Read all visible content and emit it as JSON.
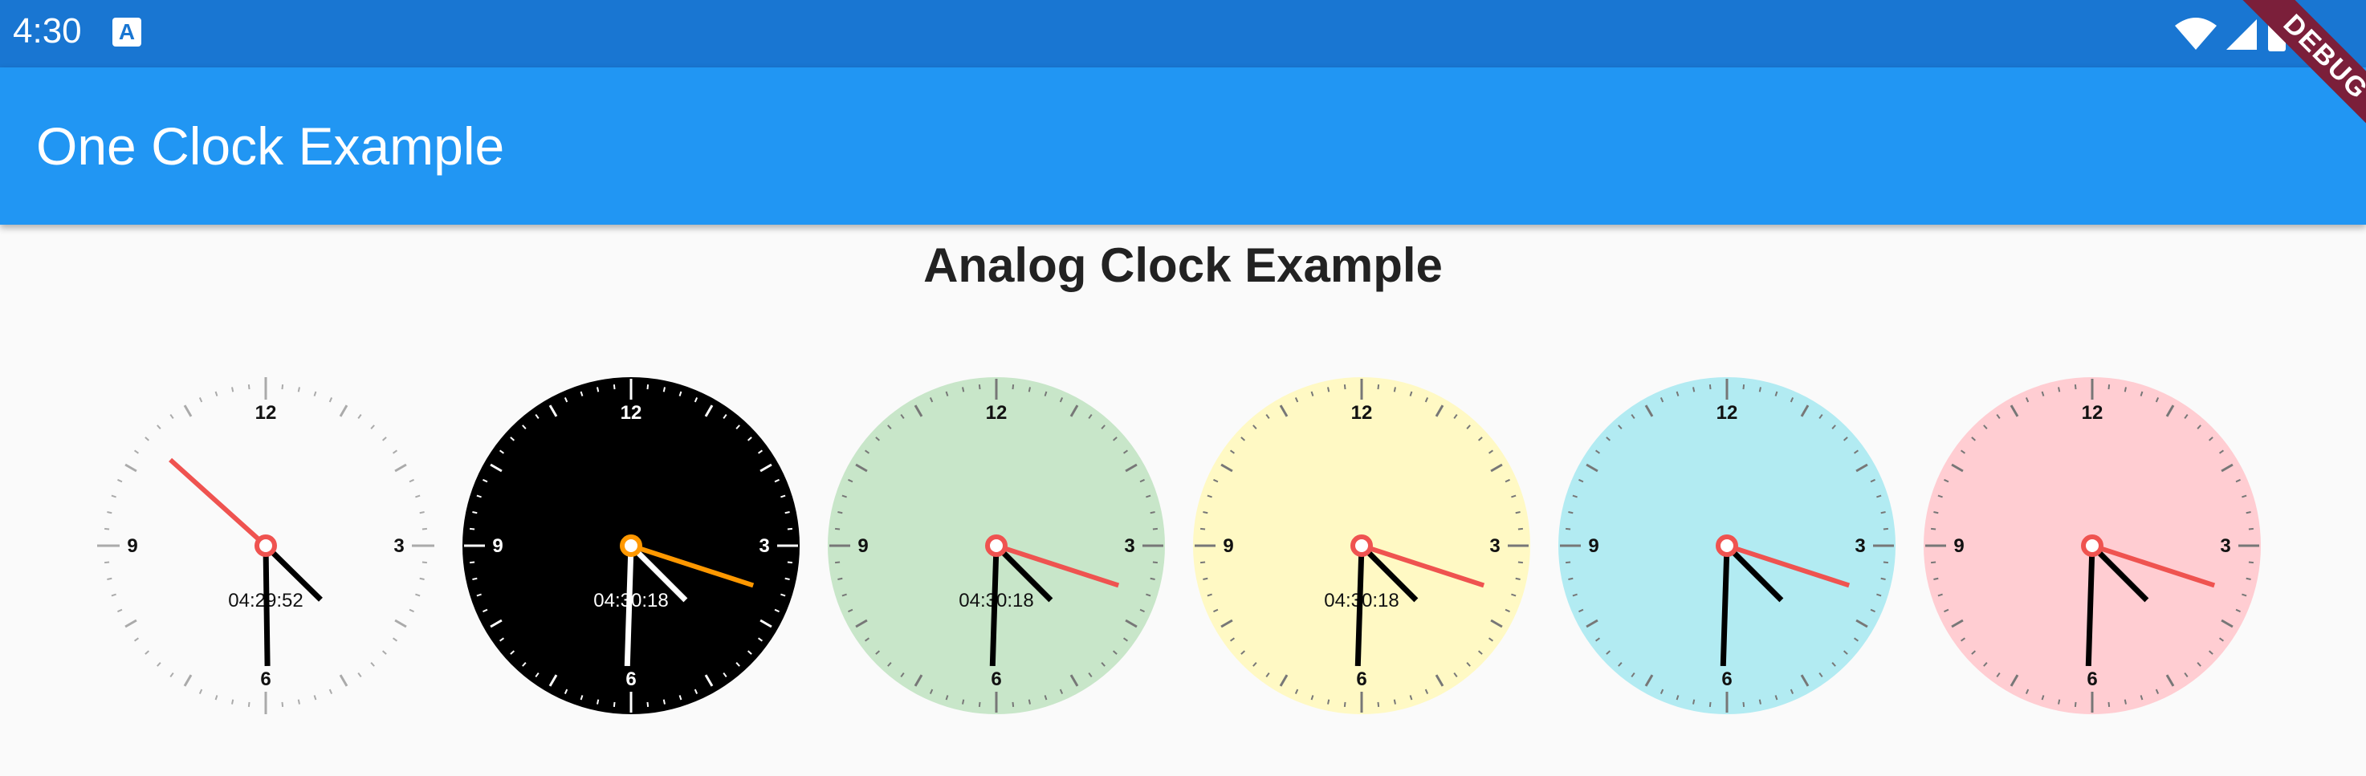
{
  "status_bar": {
    "time": "4:30",
    "notification_icon": "A",
    "icons": [
      "wifi-icon",
      "cellular-signal-icon",
      "battery-icon"
    ]
  },
  "app_bar": {
    "title": "One Clock Example"
  },
  "debug_banner": {
    "label": "DEBUG",
    "color": "#7b1f3a"
  },
  "page": {
    "heading": "Analog Clock Example"
  },
  "clocks": [
    {
      "face": "#fafafa",
      "numbers": "#111111",
      "ticks": "#aaaaaa",
      "hour_hand": "#000000",
      "minute_hand": "#000000",
      "second_hand": "#ef5350",
      "center": "#ef5350",
      "digital": "04:29:52",
      "hour": 4,
      "minute": 29,
      "second": 52,
      "digital_color": "#111111"
    },
    {
      "face": "#000000",
      "numbers": "#ffffff",
      "ticks": "#ffffff",
      "hour_hand": "#ffffff",
      "minute_hand": "#ffffff",
      "second_hand": "#ff9800",
      "center": "#ff9800",
      "digital": "04:30:18",
      "hour": 4,
      "minute": 30,
      "second": 18,
      "digital_color": "#ffffff"
    },
    {
      "face": "#c8e6c9",
      "numbers": "#111111",
      "ticks": "#777777",
      "hour_hand": "#000000",
      "minute_hand": "#000000",
      "second_hand": "#ef5350",
      "center": "#ef5350",
      "digital": "04:30:18",
      "hour": 4,
      "minute": 30,
      "second": 18,
      "digital_color": "#111111"
    },
    {
      "face": "#fff9c4",
      "numbers": "#111111",
      "ticks": "#777777",
      "hour_hand": "#000000",
      "minute_hand": "#000000",
      "second_hand": "#ef5350",
      "center": "#ef5350",
      "digital": "04:30:18",
      "hour": 4,
      "minute": 30,
      "second": 18,
      "digital_color": "#111111"
    },
    {
      "face": "#b2ebf2",
      "numbers": "#111111",
      "ticks": "#777777",
      "hour_hand": "#000000",
      "minute_hand": "#000000",
      "second_hand": "#ef5350",
      "center": "#ef5350",
      "digital": "",
      "hour": 4,
      "minute": 30,
      "second": 18,
      "digital_color": "#111111"
    },
    {
      "face": "#ffcdd2",
      "numbers": "#111111",
      "ticks": "#777777",
      "hour_hand": "#000000",
      "minute_hand": "#000000",
      "second_hand": "#ef5350",
      "center": "#ef5350",
      "digital": "",
      "hour": 4,
      "minute": 30,
      "second": 18,
      "digital_color": "#111111"
    }
  ],
  "dial_numbers": [
    "12",
    "3",
    "6",
    "9"
  ]
}
